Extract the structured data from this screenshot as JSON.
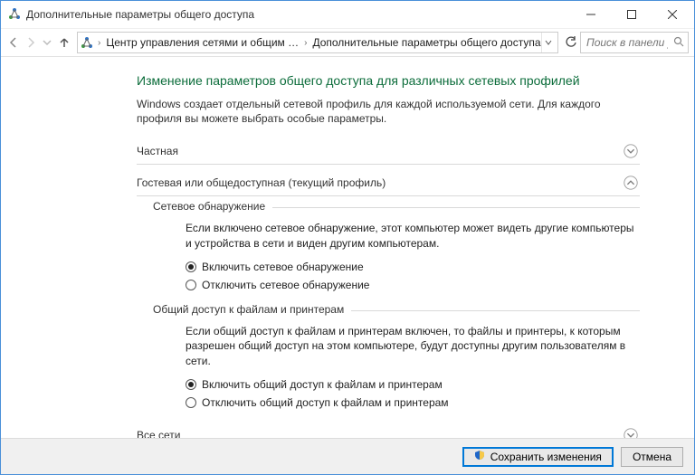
{
  "window": {
    "title": "Дополнительные параметры общего доступа"
  },
  "nav": {
    "crumbs": [
      "Центр управления сетями и общим …",
      "Дополнительные параметры общего доступа"
    ],
    "search_placeholder": "Поиск в панели управления"
  },
  "page": {
    "heading": "Изменение параметров общего доступа для различных сетевых профилей",
    "desc": "Windows создает отдельный сетевой профиль для каждой используемой сети. Для каждого профиля вы можете выбрать особые параметры."
  },
  "profiles": {
    "private": {
      "label": "Частная",
      "expanded": false
    },
    "guest": {
      "label": "Гостевая или общедоступная (текущий профиль)",
      "expanded": true
    },
    "all": {
      "label": "Все сети",
      "expanded": false
    }
  },
  "guest": {
    "discovery": {
      "legend": "Сетевое обнаружение",
      "desc": "Если включено сетевое обнаружение, этот компьютер может видеть другие компьютеры и устройства в сети и виден другим компьютерам.",
      "on": "Включить сетевое обнаружение",
      "off": "Отключить сетевое обнаружение",
      "value": "on"
    },
    "sharing": {
      "legend": "Общий доступ к файлам и принтерам",
      "desc": "Если общий доступ к файлам и принтерам включен, то файлы и принтеры, к которым разрешен общий доступ на этом компьютере, будут доступны другим пользователям в сети.",
      "on": "Включить общий доступ к файлам и принтерам",
      "off": "Отключить общий доступ к файлам и принтерам",
      "value": "on"
    }
  },
  "footer": {
    "save": "Сохранить изменения",
    "cancel": "Отмена"
  }
}
